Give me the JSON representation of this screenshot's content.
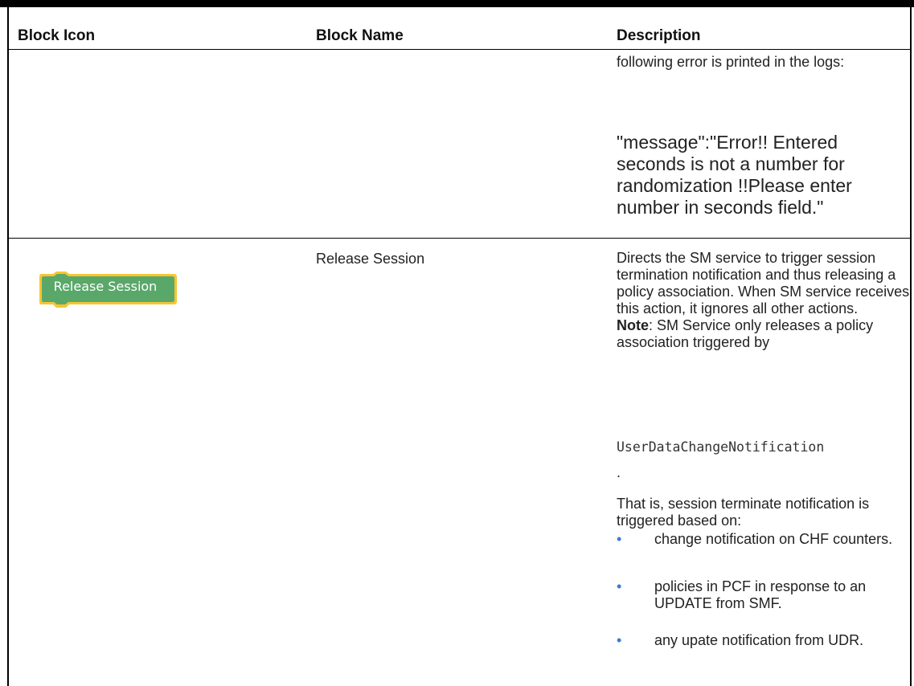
{
  "table": {
    "headers": {
      "icon": "Block Icon",
      "name": "Block Name",
      "description": "Description"
    },
    "row_continued": {
      "description_text": "following error is printed in the logs:",
      "error_message": "\"message\":\"Error!! Entered seconds is not a number for randomization !!Please enter number in seconds field.\""
    },
    "row_release": {
      "block_icon_label": "Release Session",
      "block_name": "Release Session",
      "description_main": "Directs the SM service to trigger session termination notification and thus releasing a policy association. When SM service receives this action, it ignores all other actions.",
      "note_label": "Note",
      "note_text": ": SM Service only releases a policy association triggered by",
      "note_code": "UserDataChangeNotification",
      "note_end": ".",
      "that_is": "That is, session terminate notification is triggered based on:",
      "bullets": [
        "change notification on CHF counters.",
        "policies in PCF in response to an UPDATE from SMF.",
        "any upate notification from UDR."
      ]
    }
  },
  "colors": {
    "block_fill": "#59a869",
    "block_outline": "#f7c531",
    "bullet": "#3a7bd5"
  }
}
